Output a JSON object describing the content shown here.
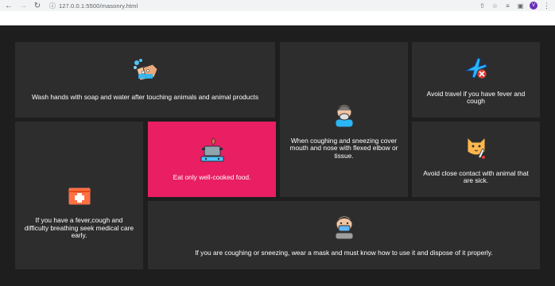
{
  "browser": {
    "url": "127.0.0.1:5500/masonry.html",
    "avatar_letter": "V"
  },
  "cards": {
    "wash": {
      "text": "Wash hands with soap and water after touching animals and animal products",
      "icon": "hand-washing-icon"
    },
    "cough_cover": {
      "text": "When coughing and sneezing cover mouth and nose with flexed elbow or tissue.",
      "icon": "coughing-person-icon"
    },
    "travel": {
      "text": "Avoid travel if you have fever and cough",
      "icon": "no-travel-icon"
    },
    "cooked": {
      "text": "Eat only well-cooked food.",
      "icon": "cooking-pot-icon"
    },
    "fever": {
      "text": "If you have a fever,cough and difficulty breathing seek medical care early.",
      "icon": "medical-kit-icon"
    },
    "animal": {
      "text": "Avoid close contact with animal that are sick.",
      "icon": "sick-cat-icon"
    },
    "mask": {
      "text": "If you are coughing or sneezing, wear a mask and must know how to use it and dispose of it properly.",
      "icon": "masked-person-icon"
    }
  },
  "colors": {
    "card": "#2d2d2d",
    "highlight": "#e91e63",
    "background": "#1e1e1e"
  }
}
